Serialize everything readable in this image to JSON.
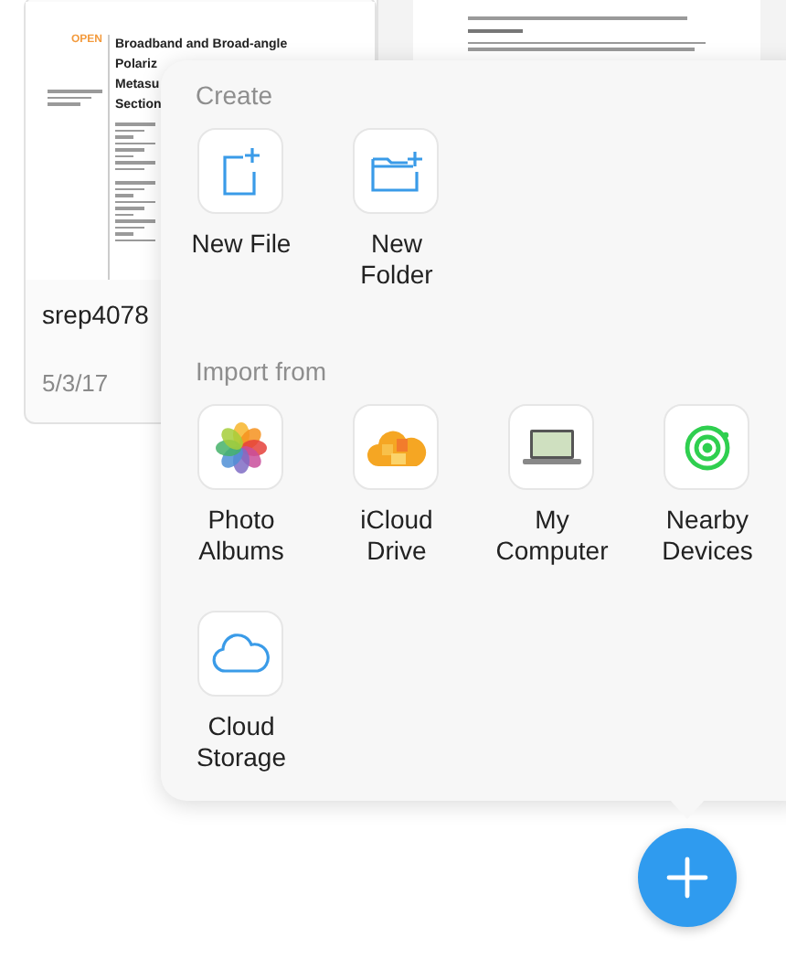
{
  "document": {
    "badge": "OPEN",
    "title_lines": [
      "Broadband and Broad-angle",
      "Polariz",
      "Metasu",
      "Section"
    ],
    "name": "srep4078",
    "date": "5/3/17"
  },
  "menu": {
    "sections": [
      {
        "title": "Create",
        "items": [
          {
            "kind": "new-file",
            "label_lines": [
              "New File"
            ]
          },
          {
            "kind": "new-folder",
            "label_lines": [
              "New",
              "Folder"
            ]
          }
        ]
      },
      {
        "title": "Import from",
        "items": [
          {
            "kind": "photos",
            "label_lines": [
              "Photo",
              "Albums"
            ]
          },
          {
            "kind": "icloud",
            "label_lines": [
              "iCloud",
              "Drive"
            ]
          },
          {
            "kind": "computer",
            "label_lines": [
              "My",
              "Computer"
            ]
          },
          {
            "kind": "nearby",
            "label_lines": [
              "Nearby",
              "Devices"
            ]
          },
          {
            "kind": "cloud",
            "label_lines": [
              "Cloud",
              "Storage"
            ]
          }
        ]
      }
    ]
  }
}
